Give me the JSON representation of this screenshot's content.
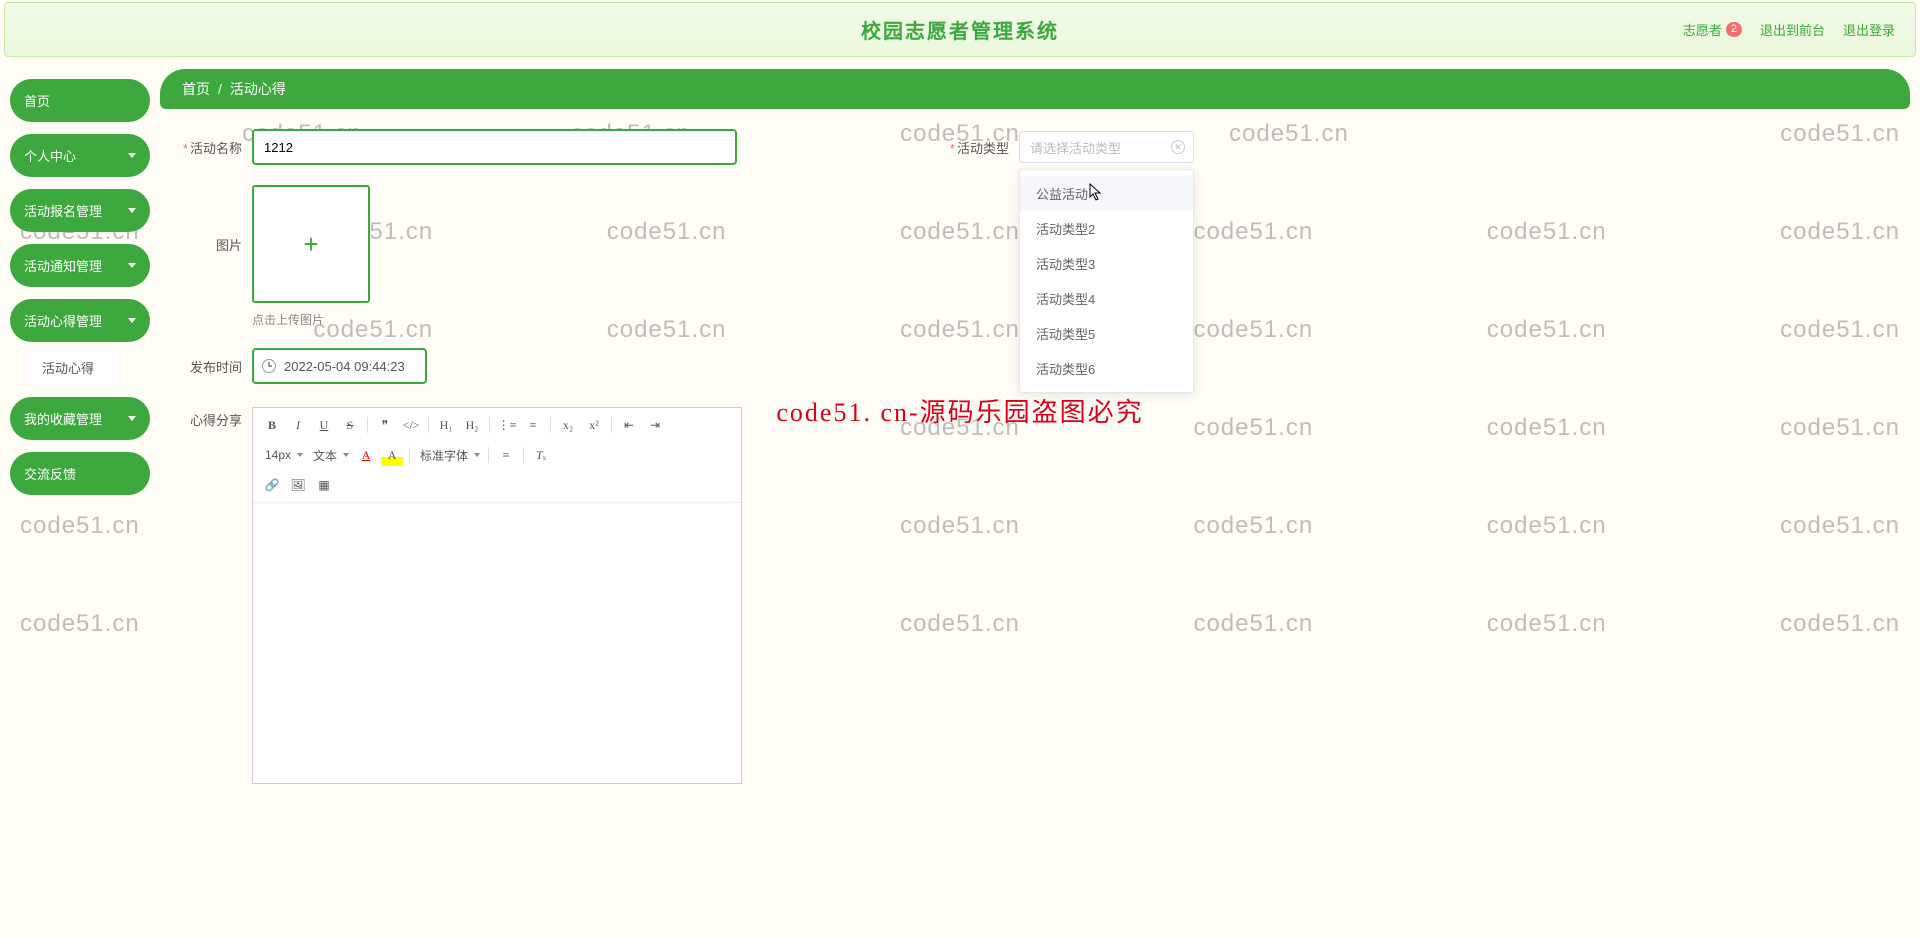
{
  "watermark_text": "code51.cn",
  "center_watermark": "code51. cn-源码乐园盗图必究",
  "header": {
    "title": "校园志愿者管理系统",
    "user_label": "志愿者",
    "user_badge": "2",
    "link_front": "退出到前台",
    "link_logout": "退出登录"
  },
  "sidebar": {
    "items": [
      {
        "label": "首页",
        "has_arrow": false
      },
      {
        "label": "个人中心",
        "has_arrow": true
      },
      {
        "label": "活动报名管理",
        "has_arrow": true
      },
      {
        "label": "活动通知管理",
        "has_arrow": true
      },
      {
        "label": "活动心得管理",
        "has_arrow": true
      },
      {
        "label": "我的收藏管理",
        "has_arrow": true
      },
      {
        "label": "交流反馈",
        "has_arrow": false
      }
    ],
    "sub_item": "活动心得"
  },
  "breadcrumb": {
    "root": "首页",
    "sep": "/",
    "current": "活动心得"
  },
  "form": {
    "activity_name": {
      "label": "活动名称",
      "value": "1212"
    },
    "activity_type": {
      "label": "活动类型",
      "placeholder": "请选择活动类型"
    },
    "image": {
      "label": "图片",
      "hint": "点击上传图片"
    },
    "publish_time": {
      "label": "发布时间",
      "value": "2022-05-04 09:44:23"
    },
    "share": {
      "label": "心得分享"
    }
  },
  "dropdown_options": [
    "公益活动",
    "活动类型2",
    "活动类型3",
    "活动类型4",
    "活动类型5",
    "活动类型6"
  ],
  "editor_toolbar": {
    "font_size": "14px",
    "font_type": "文本",
    "font_family": "标准字体"
  }
}
